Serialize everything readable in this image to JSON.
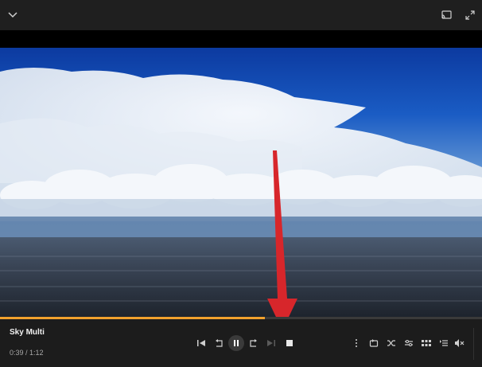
{
  "window": {
    "top_left_icon": "chevron-down-icon",
    "top_right_icons": [
      "cast-icon",
      "fullscreen-icon"
    ]
  },
  "video": {
    "scene": "sky-clouds-sea",
    "overlay_annotation": "red-arrow-pointing-to-stop-button"
  },
  "playback": {
    "progress": 0.55,
    "progress_color": "#f0a12d"
  },
  "track": {
    "title": "Sky Multi",
    "current_time": "0:39",
    "separator": " / ",
    "duration": "1:12"
  },
  "controls": {
    "center": [
      "skip-previous-icon",
      "rewind-icon",
      "pause-icon",
      "fast-forward-icon",
      "skip-next-icon",
      "stop-icon"
    ],
    "right": [
      "more-icon",
      "repeat-icon",
      "shuffle-icon",
      "equalizer-icon",
      "grid-icon",
      "playlist-icon",
      "mute-icon"
    ]
  },
  "colors": {
    "accent": "#f0a12d",
    "background": "#1c1c1c",
    "arrow": "#d7262b"
  }
}
